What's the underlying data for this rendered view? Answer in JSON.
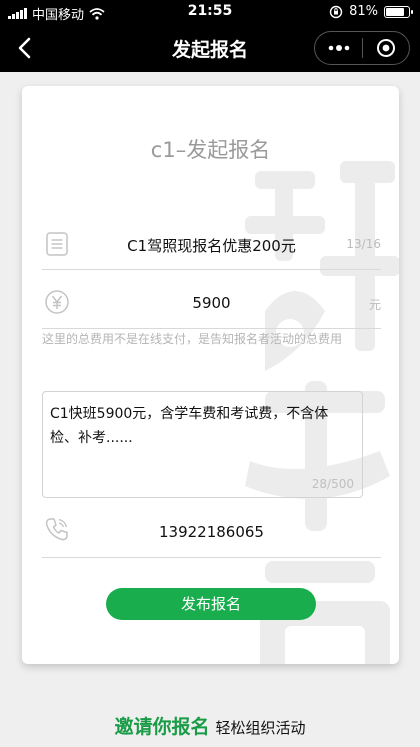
{
  "status_bar": {
    "carrier": "中国移动",
    "time": "21:55",
    "battery_text": "81%",
    "battery_level": 0.81
  },
  "nav": {
    "title": "发起报名",
    "back_icon": "chevron-left-icon",
    "more_icon": "more-dots-icon",
    "close_icon": "target-circle-icon"
  },
  "form": {
    "card_title": "c1–发起报名",
    "name": {
      "value": "C1驾照现报名优惠200元",
      "count": "13/16",
      "icon": "document-icon"
    },
    "fee": {
      "value": "5900",
      "unit": "元",
      "icon": "yuan-icon",
      "hint": "这里的总费用不是在线支付，是告知报名者活动的总费用"
    },
    "description": {
      "value": "C1快班5900元，含学车费和考试费，不含体检、补考......",
      "count": "28/500"
    },
    "phone": {
      "value": "13922186065",
      "icon": "phone-icon"
    },
    "submit_label": "发布报名"
  },
  "footer": {
    "slogan_main": "邀请你报名",
    "slogan_sub": "轻松组织活动"
  },
  "colors": {
    "accent": "#19ad4e",
    "slogan": "#1a9b47",
    "bar": "#000000",
    "background": "#efefef"
  }
}
